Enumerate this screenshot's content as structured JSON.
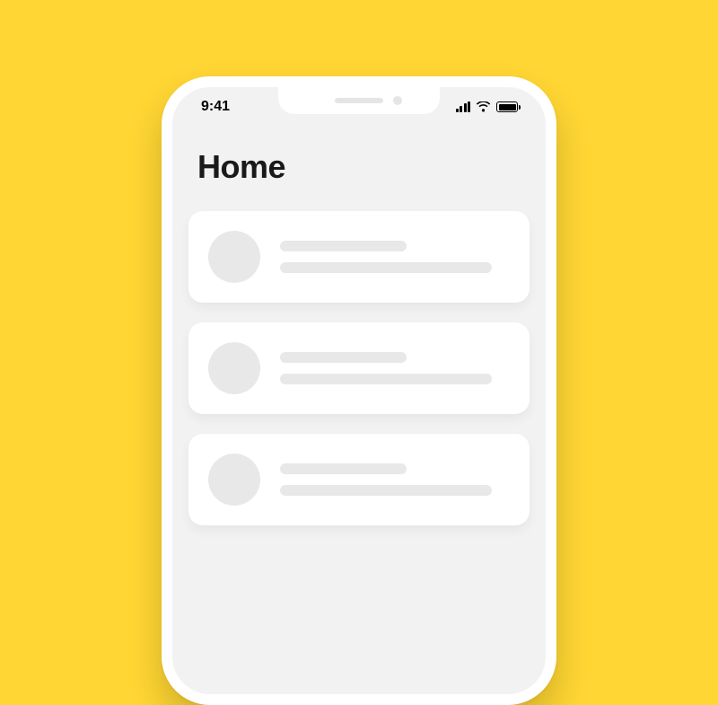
{
  "status_bar": {
    "time": "9:41"
  },
  "header": {
    "title": "Home"
  }
}
